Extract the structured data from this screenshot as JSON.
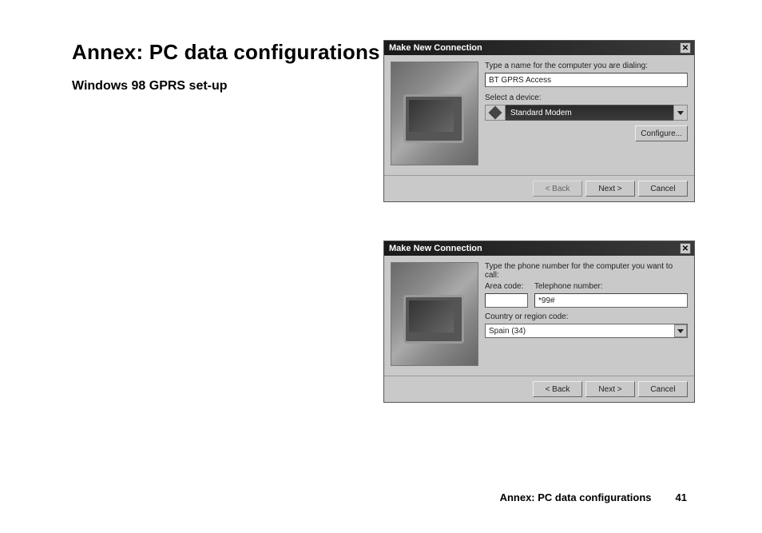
{
  "heading": "Annex: PC data configurations",
  "subheading": "Windows 98 GPRS set-up",
  "dialog1": {
    "title": "Make New Connection",
    "prompt": "Type a name for the computer you are dialing:",
    "name_value": "BT GPRS Access",
    "device_label": "Select a device:",
    "device_value": "Standard Modem",
    "configure_btn": "Configure...",
    "back_btn": "< Back",
    "next_btn": "Next >",
    "cancel_btn": "Cancel"
  },
  "dialog2": {
    "title": "Make New Connection",
    "prompt": "Type the phone number for the computer you want to call:",
    "area_label": "Area code:",
    "area_value": "",
    "phone_label": "Telephone number:",
    "phone_value": "*99#",
    "country_label": "Country or region code:",
    "country_value": "Spain (34)",
    "back_btn": "< Back",
    "next_btn": "Next >",
    "cancel_btn": "Cancel"
  },
  "footer_text": "Annex: PC data configurations",
  "footer_page": "41"
}
